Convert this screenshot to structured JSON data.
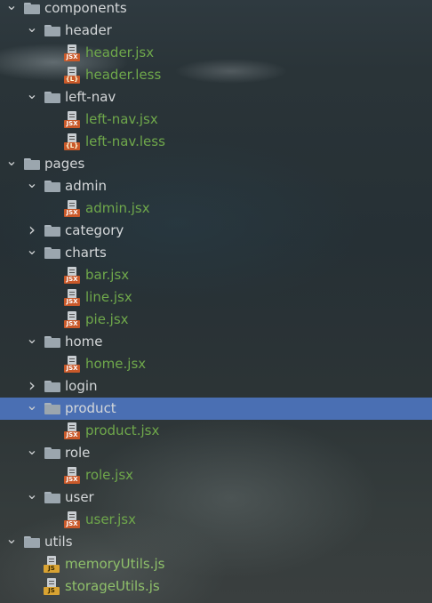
{
  "tree": [
    {
      "label": "components",
      "kind": "folder",
      "depth": 0,
      "expanded": true
    },
    {
      "label": "header",
      "kind": "folder",
      "depth": 1,
      "expanded": true
    },
    {
      "label": "header.jsx",
      "kind": "file",
      "badge": "JSX",
      "depth": 2
    },
    {
      "label": "header.less",
      "kind": "file",
      "badge": "{L}",
      "depth": 2
    },
    {
      "label": "left-nav",
      "kind": "folder",
      "depth": 1,
      "expanded": true
    },
    {
      "label": "left-nav.jsx",
      "kind": "file",
      "badge": "JSX",
      "depth": 2
    },
    {
      "label": "left-nav.less",
      "kind": "file",
      "badge": "{L}",
      "depth": 2
    },
    {
      "label": "pages",
      "kind": "folder",
      "depth": 0,
      "expanded": true
    },
    {
      "label": "admin",
      "kind": "folder",
      "depth": 1,
      "expanded": true
    },
    {
      "label": "admin.jsx",
      "kind": "file",
      "badge": "JSX",
      "depth": 2
    },
    {
      "label": "category",
      "kind": "folder",
      "depth": 1,
      "expanded": false
    },
    {
      "label": "charts",
      "kind": "folder",
      "depth": 1,
      "expanded": true
    },
    {
      "label": "bar.jsx",
      "kind": "file",
      "badge": "JSX",
      "depth": 2
    },
    {
      "label": "line.jsx",
      "kind": "file",
      "badge": "JSX",
      "depth": 2
    },
    {
      "label": "pie.jsx",
      "kind": "file",
      "badge": "JSX",
      "depth": 2
    },
    {
      "label": "home",
      "kind": "folder",
      "depth": 1,
      "expanded": true
    },
    {
      "label": "home.jsx",
      "kind": "file",
      "badge": "JSX",
      "depth": 2
    },
    {
      "label": "login",
      "kind": "folder",
      "depth": 1,
      "expanded": false
    },
    {
      "label": "product",
      "kind": "folder",
      "depth": 1,
      "expanded": true,
      "selected": true
    },
    {
      "label": "product.jsx",
      "kind": "file",
      "badge": "JSX",
      "depth": 2
    },
    {
      "label": "role",
      "kind": "folder",
      "depth": 1,
      "expanded": true
    },
    {
      "label": "role.jsx",
      "kind": "file",
      "badge": "JSX",
      "depth": 2
    },
    {
      "label": "user",
      "kind": "folder",
      "depth": 1,
      "expanded": true
    },
    {
      "label": "user.jsx",
      "kind": "file",
      "badge": "JSX",
      "depth": 2
    },
    {
      "label": "utils",
      "kind": "folder",
      "depth": 0,
      "expanded": true
    },
    {
      "label": "memoryUtils.js",
      "kind": "file",
      "badge": "JS",
      "depth": 1
    },
    {
      "label": "storageUtils.js",
      "kind": "file",
      "badge": "JS",
      "depth": 1
    }
  ],
  "icons": {
    "expanded": "chevron-down-icon",
    "collapsed": "chevron-right-icon",
    "folder": "folder-icon",
    "jsx": "jsx-file-icon",
    "less": "less-file-icon",
    "js": "js-file-icon"
  },
  "colors": {
    "selection": "#4a6fb3",
    "folder_text": "#d4d7d9",
    "file_text": "#6fa84b",
    "jsx_badge": "#c9592a",
    "js_badge": "#d9a332"
  }
}
